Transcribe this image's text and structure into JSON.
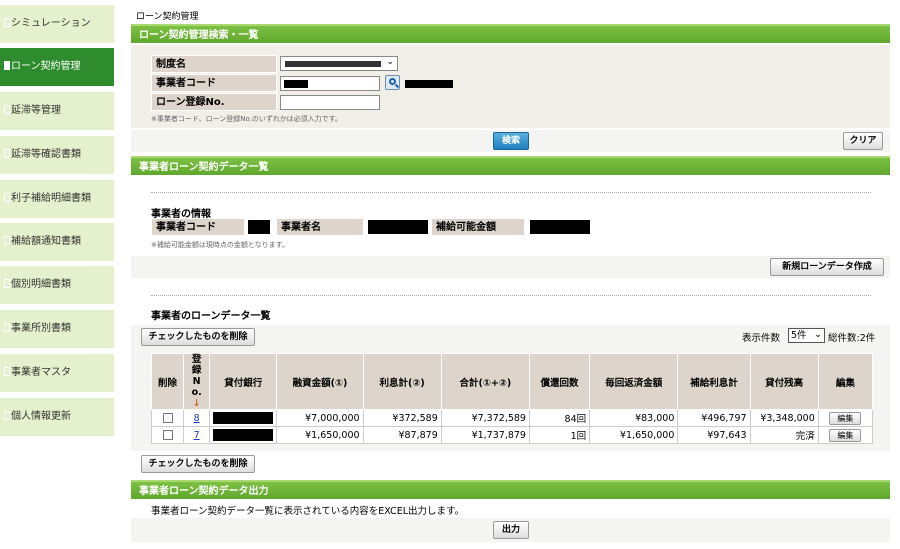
{
  "sidebar": {
    "items": [
      {
        "label": "シミュレーション"
      },
      {
        "label": "ローン契約管理"
      },
      {
        "label": "延滞等管理"
      },
      {
        "label": "延滞等確認書類"
      },
      {
        "label": "利子補給明細書類"
      },
      {
        "label": "補給額通知書類"
      },
      {
        "label": "個別明細書類"
      },
      {
        "label": "事業所別書類"
      },
      {
        "label": "事業者マスタ"
      },
      {
        "label": "個人情報更新"
      }
    ]
  },
  "breadcrumb": "ローン契約管理",
  "search": {
    "bar_title": "ローン契約管理検索・一覧",
    "label_system": "制度名",
    "label_code": "事業者コード",
    "label_loan_no": "ローン登録No.",
    "note": "※事業者コード、ローン登録No.のいずれかは必須入力です。",
    "search_button": "検索",
    "clear_button": "クリア"
  },
  "loan_list": {
    "bar_title": "事業者ローン契約データ一覧",
    "info_title": "事業者の情報",
    "label_code": "事業者コード",
    "label_name": "事業者名",
    "label_amount": "補給可能金額",
    "info_note": "※補給可能金額は現時点の金額となります。",
    "new_button": "新規ローンデータ作成",
    "data_title": "事業者のローンデータ一覧",
    "delete_button": "チェックしたものを削除",
    "display_label": "表示件数",
    "display_value": "5件",
    "total_label": "総件数:2件",
    "columns": [
      "削除",
      "登録No.",
      "貸付銀行",
      "融資金額(①)",
      "利息計(②)",
      "合計(①+②)",
      "償還回数",
      "毎回返済金額",
      "補給利息計",
      "貸付残高",
      "編集"
    ],
    "rows": [
      {
        "reg_no": "8",
        "amount": "¥7,000,000",
        "interest": "¥372,589",
        "total": "¥7,372,589",
        "count": "84回",
        "payment": "¥83,000",
        "subsidy": "¥496,797",
        "balance": "¥3,348,000",
        "edit": "編集"
      },
      {
        "reg_no": "7",
        "amount": "¥1,650,000",
        "interest": "¥87,879",
        "total": "¥1,737,879",
        "count": "1回",
        "payment": "¥1,650,000",
        "subsidy": "¥97,643",
        "balance": "完済",
        "edit": "編集"
      }
    ]
  },
  "export": {
    "bar_title": "事業者ローン契約データ出力",
    "description": "事業者ローン契約データ一覧に表示されている内容をEXCEL出力します。",
    "button": "出力"
  }
}
